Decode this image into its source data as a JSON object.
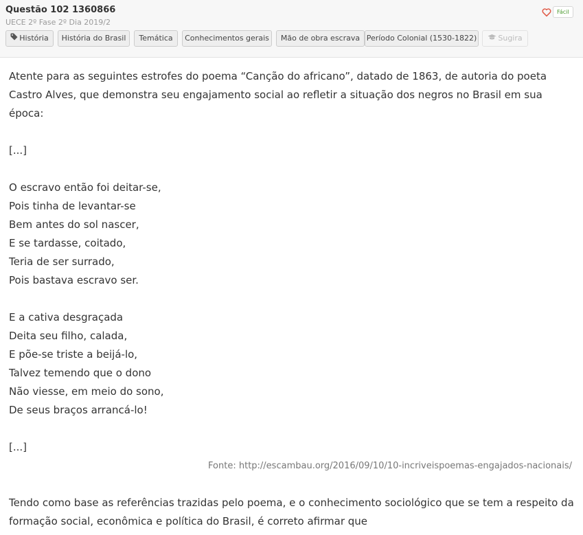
{
  "header": {
    "title": "Questão 102 1360866",
    "subtitle": "UECE 2º Fase 2º Dia 2019/2",
    "difficulty": "Fácil"
  },
  "tags": [
    "História",
    "História do Brasil",
    "Temática",
    "Conhecimentos gerais",
    "Mão de obra escrava",
    "Período Colonial (1530-1822)"
  ],
  "suggest_label": "Sugira",
  "icons": {
    "favorite": "heart-outline-icon",
    "tag": "tag-icon",
    "suggest": "graduation-cap-icon"
  },
  "colors": {
    "heart": "#e05a47",
    "difficulty": "#4a9a2e"
  },
  "question": {
    "intro": "Atente para as seguintes estrofes do poema “Canção do africano”, datado de 1863, de autoria do poeta Castro Alves, que demonstra seu engajamento social ao refletir a situação dos negros no Brasil em sua época:",
    "ellipsis_top": "[...]",
    "stanza1": [
      "O escravo então foi deitar-se,",
      "Pois tinha de levantar-se",
      "Bem antes do sol nascer,",
      "E se tardasse, coitado,",
      "Teria de ser surrado,",
      "Pois bastava escravo ser."
    ],
    "stanza2": [
      "E a cativa desgraçada",
      "Deita seu filho, calada,",
      "E põe-se triste a beijá-lo,",
      "Talvez temendo que o dono",
      "Não viesse, em meio do sono,",
      "De seus braços arrancá-lo!"
    ],
    "ellipsis_bottom": "[...]",
    "source": "Fonte: http://escambau.org/2016/09/10/10-incriveispoemas-engajados-nacionais/",
    "prompt": "Tendo como base as referências trazidas pelo poema, e o conhecimento sociológico que se tem a respeito da formação social, econômica e política do Brasil, é correto afirmar que"
  }
}
